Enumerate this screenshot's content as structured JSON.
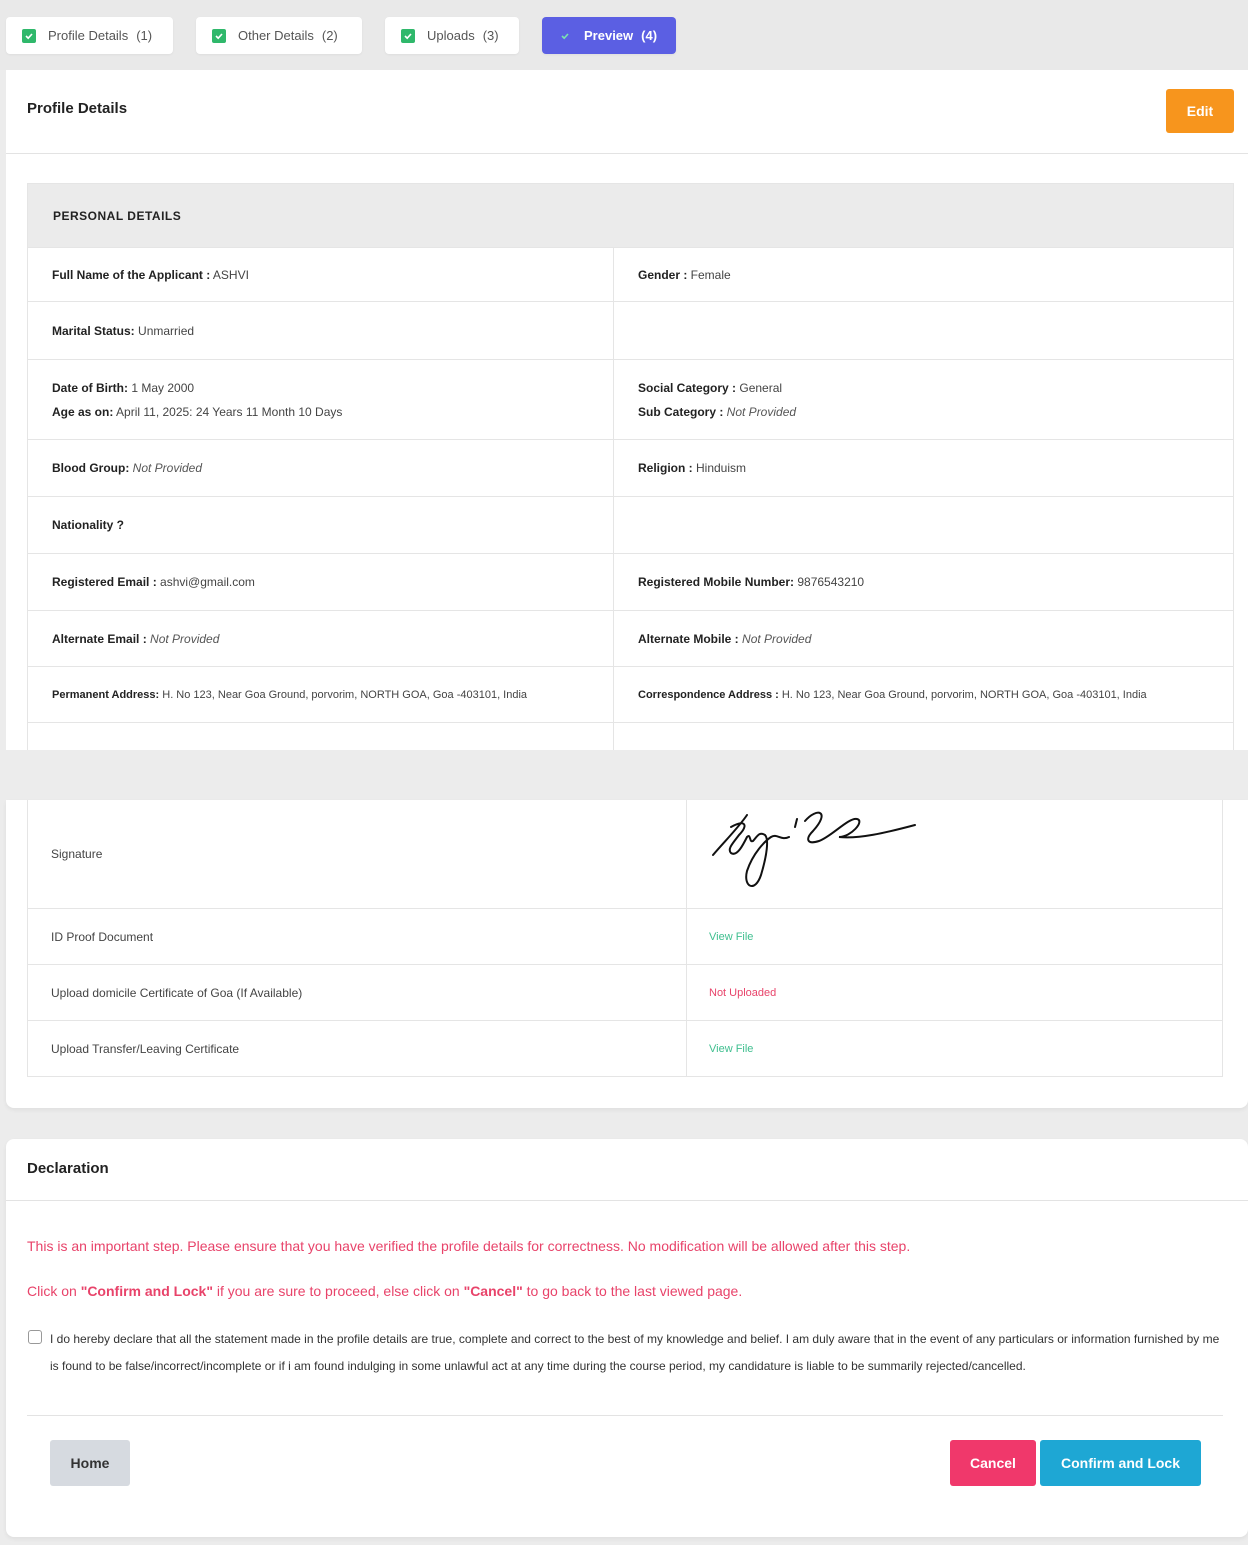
{
  "tabs": [
    {
      "label": "Profile Details",
      "num": "(1)",
      "active": false
    },
    {
      "label": "Other Details",
      "num": "(2)",
      "active": false
    },
    {
      "label": "Uploads",
      "num": "(3)",
      "active": false
    },
    {
      "label": "Preview",
      "num": "(4)",
      "active": true
    }
  ],
  "profile": {
    "title": "Profile Details",
    "edit_label": "Edit"
  },
  "personal": {
    "heading": "PERSONAL DETAILS",
    "full_name_label": "Full Name of the Applicant :",
    "full_name": " ASHVI",
    "gender_label": "Gender :",
    "gender": " Female",
    "marital_label": "Marital Status:",
    "marital": " Unmarried",
    "dob_label": "Date of Birth:",
    "dob": " 1 May 2000",
    "age_label": "Age as on:",
    "age": " April 11, 2025: 24 Years 11 Month 10 Days",
    "social_label": "Social Category :",
    "social": " General",
    "sub_label": "Sub Category :",
    "sub": " Not Provided",
    "blood_label": "Blood Group:",
    "blood": " Not Provided",
    "religion_label": "Religion :",
    "religion": " Hinduism",
    "nationality_label": "Nationality ?",
    "reg_email_label": "Registered Email :",
    "reg_email": " ashvi@gmail.com",
    "reg_mobile_label": "Registered Mobile Number:",
    "reg_mobile": " 9876543210",
    "alt_email_label": "Alternate Email :",
    "alt_email": " Not Provided",
    "alt_mobile_label": "Alternate Mobile :",
    "alt_mobile": " Not Provided",
    "perm_addr_label": "Permanent Address:",
    "perm_addr": " H. No 123, Near Goa Ground, porvorim, NORTH GOA, Goa -403101, India",
    "corr_addr_label": "Correspondence Address :",
    "corr_addr": " H. No 123, Near Goa Ground, porvorim, NORTH GOA, Goa -403101, India"
  },
  "uploads": [
    {
      "label": "Signature",
      "value": "",
      "type": "signature"
    },
    {
      "label": "ID Proof Document",
      "value": "View File",
      "type": "link"
    },
    {
      "label": "Upload domicile Certificate of Goa (If Available)",
      "value": "Not Uploaded",
      "type": "missing"
    },
    {
      "label": "Upload Transfer/Leaving Certificate",
      "value": "View File",
      "type": "link"
    }
  ],
  "declaration": {
    "title": "Declaration",
    "warning1": "This is an important step. Please ensure that you have verified the profile details for correctness. No modification will be allowed after this step.",
    "warning2_pre": "Click on ",
    "warning2_confirm": "\"Confirm and Lock\"",
    "warning2_mid": " if you are sure to proceed, else click on ",
    "warning2_cancel": "\"Cancel\"",
    "warning2_post": " to go back to the last viewed page.",
    "statement": "I do hereby declare that all the statement made in the profile details are true, complete and correct to the best of my knowledge and belief. I am duly aware that in the event of any particulars or information furnished by me is found to be false/incorrect/incomplete or if i am found indulging in some unlawful act at any time during the course period, my candidature is liable to be summarily rejected/cancelled.",
    "home_label": "Home",
    "cancel_label": "Cancel",
    "confirm_label": "Confirm and Lock"
  },
  "colors": {
    "active_tab": "#5b5fe3",
    "check_green": "#2fb86b",
    "edit_orange": "#f7951d",
    "warning_red": "#e8436a",
    "cancel_pink": "#f0386b",
    "confirm_blue": "#1ea7d4",
    "link_green": "#3fbf8f"
  }
}
